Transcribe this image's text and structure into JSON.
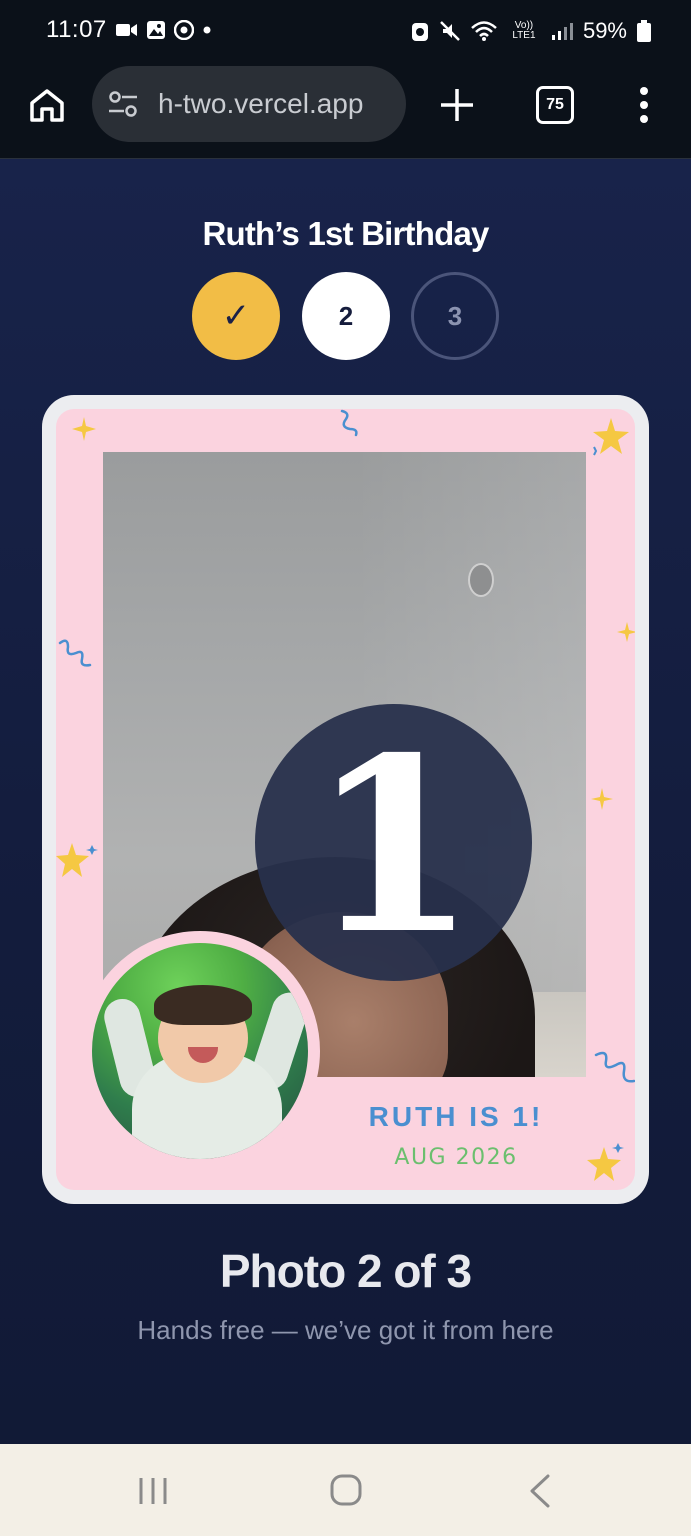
{
  "status_bar": {
    "time": "11:07",
    "battery": "59%",
    "network": "Vo)) LTE1"
  },
  "browser": {
    "url": "h-two.vercel.app",
    "tab_count": "75"
  },
  "page": {
    "title": "Ruth’s 1st Birthday",
    "steps": [
      {
        "label": "✓",
        "state": "done"
      },
      {
        "label": "2",
        "state": "active"
      },
      {
        "label": "3",
        "state": "pending"
      }
    ],
    "countdown": "1",
    "frame": {
      "caption": "RUTH IS 1!",
      "date": "AUG 2026"
    },
    "status": "Photo 2 of 3",
    "subtitle": "Hands free — we’ve got it from here"
  },
  "colors": {
    "background": "#151f42",
    "step_done": "#f2bd46",
    "frame_pink": "#fbd3df",
    "caption_blue": "#4a8fd0",
    "date_green": "#6bbf6e"
  }
}
